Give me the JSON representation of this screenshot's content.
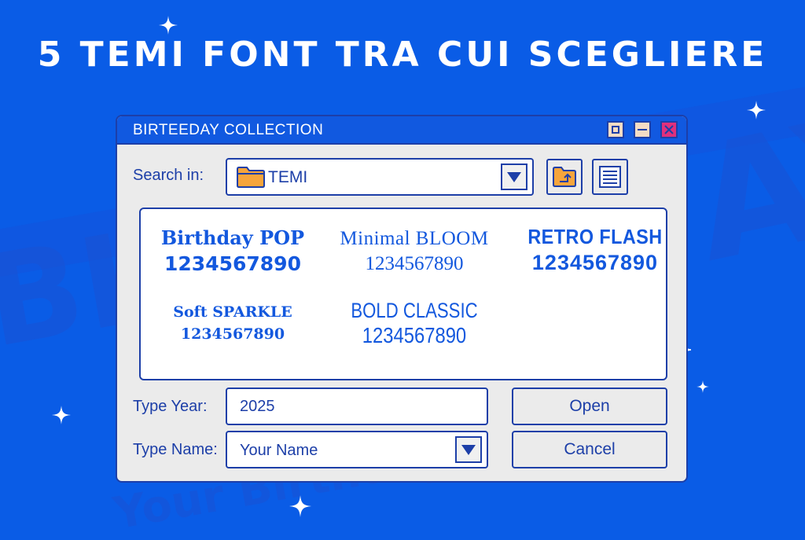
{
  "banner": {
    "headline": "5 TEMI FONT TRA CUI SCEGLIERE"
  },
  "background": {
    "text_large_left": "BI CO",
    "text_large_right": "AY OF",
    "text_line": "Your Birthday your tee"
  },
  "window": {
    "title": "BIRTEEDAY COLLECTION",
    "controls": [
      "maximize",
      "minimize",
      "close"
    ]
  },
  "search": {
    "label": "Search in:",
    "value": "TEMI",
    "icon": "folder-icon"
  },
  "toolbar": {
    "up_folder_icon": "folder-up-icon",
    "list_view_icon": "list-view-icon"
  },
  "fonts": [
    {
      "name": "Birthday POP",
      "sample": "1234567890"
    },
    {
      "name": "Minimal BLOOM",
      "sample": "1234567890"
    },
    {
      "name": "RETRO FLASH",
      "sample": "1234567890"
    },
    {
      "name": "Soft SPARKLE",
      "sample": "1234567890"
    },
    {
      "name": "BOLD CLASSIC",
      "sample": "1234567890"
    }
  ],
  "form": {
    "year_label": "Type Year:",
    "year_value": "2025",
    "name_label": "Type Name:",
    "name_value": "Your Name"
  },
  "buttons": {
    "open": "Open",
    "cancel": "Cancel"
  },
  "colors": {
    "background": "#0a5ce6",
    "accent": "#1d3fa8",
    "folder": "#f6a53c",
    "close": "#e0307c"
  }
}
